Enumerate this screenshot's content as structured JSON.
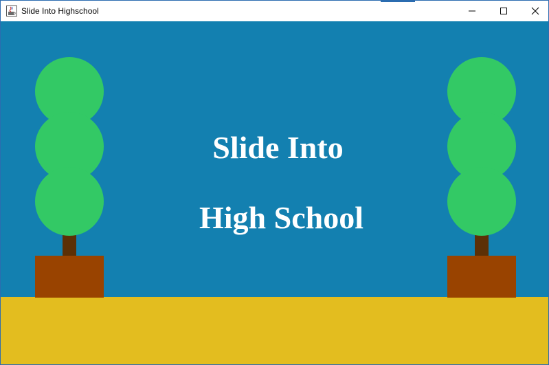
{
  "window": {
    "title": "Slide Into Highschool",
    "app_icon": "java-cup-icon",
    "controls": {
      "minimize_icon": "minimize-icon",
      "maximize_icon": "maximize-icon",
      "close_icon": "close-icon"
    }
  },
  "game": {
    "title_line1": "Slide Into",
    "title_line2": "High School"
  },
  "colors": {
    "sky": "#1380b0",
    "ground": "#e3bd1f",
    "foliage": "#33c965",
    "trunk": "#5c3006",
    "pot": "#994300",
    "title_text": "#ffffff"
  }
}
